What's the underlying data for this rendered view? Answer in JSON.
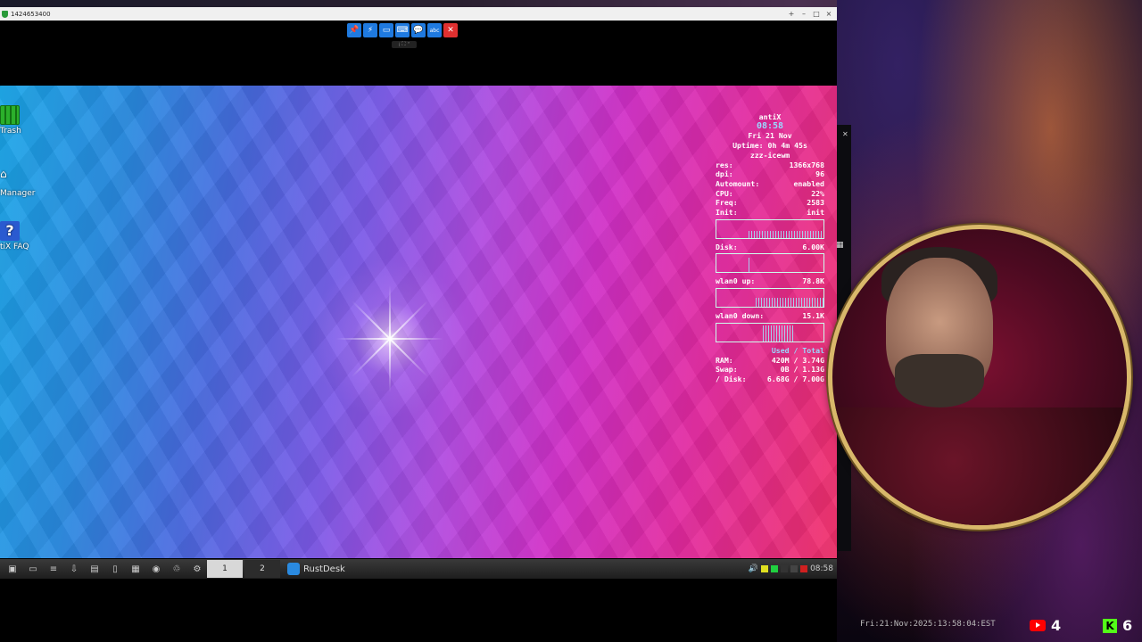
{
  "window": {
    "title": "1424653400",
    "controls": [
      "+",
      "–",
      "□",
      "×"
    ]
  },
  "toolbar": {
    "buttons": [
      {
        "name": "pin",
        "glyph": "📌"
      },
      {
        "name": "action",
        "glyph": "⚡"
      },
      {
        "name": "display",
        "glyph": "▭"
      },
      {
        "name": "keyboard",
        "glyph": "⌨"
      },
      {
        "name": "chat",
        "glyph": "💬"
      },
      {
        "name": "abc",
        "glyph": "abc"
      },
      {
        "name": "close",
        "glyph": "✕"
      }
    ]
  },
  "desktop_icons": [
    {
      "label": "Trash",
      "icon": "trash-icon"
    },
    {
      "label": "Manager",
      "icon": "home-icon"
    },
    {
      "label": "tiX FAQ",
      "icon": "help-icon"
    }
  ],
  "conky": {
    "hostname": "antiX",
    "time": "08:58",
    "date": "Fri 21 Nov",
    "uptime": "Uptime: 0h 4m 45s",
    "session": "zzz-icewm",
    "stats": [
      {
        "label": "res:",
        "value": "1366x768"
      },
      {
        "label": "dpi:",
        "value": "96"
      },
      {
        "label": "Automount:",
        "value": "enabled"
      },
      {
        "label": "CPU:",
        "value": "22%"
      },
      {
        "label": "Freq:",
        "value": "2583"
      },
      {
        "label": "Init:",
        "value": "init"
      }
    ],
    "disk": {
      "label": "Disk:",
      "value": "6.00K"
    },
    "wlan_up": {
      "label": "wlan0 up:",
      "value": "78.8K"
    },
    "wlan_down": {
      "label": "wlan0 down:",
      "value": "15.1K"
    },
    "mem_header": "Used / Total",
    "memory": [
      {
        "label": "RAM:",
        "value": "420M / 3.74G"
      },
      {
        "label": "Swap:",
        "value": "0B / 1.13G"
      },
      {
        "label": "/ Disk:",
        "value": "6.68G / 7.00G"
      }
    ]
  },
  "taskbar": {
    "workspaces": [
      "1",
      "2"
    ],
    "active_workspace": "1",
    "task_label": "RustDesk",
    "clock": "08:58"
  },
  "overlay": {
    "timestamp": "Fri:21:Nov:2025:13:58:04:EST",
    "youtube_count": "4",
    "kick_count": "6",
    "kick_logo": "K"
  }
}
